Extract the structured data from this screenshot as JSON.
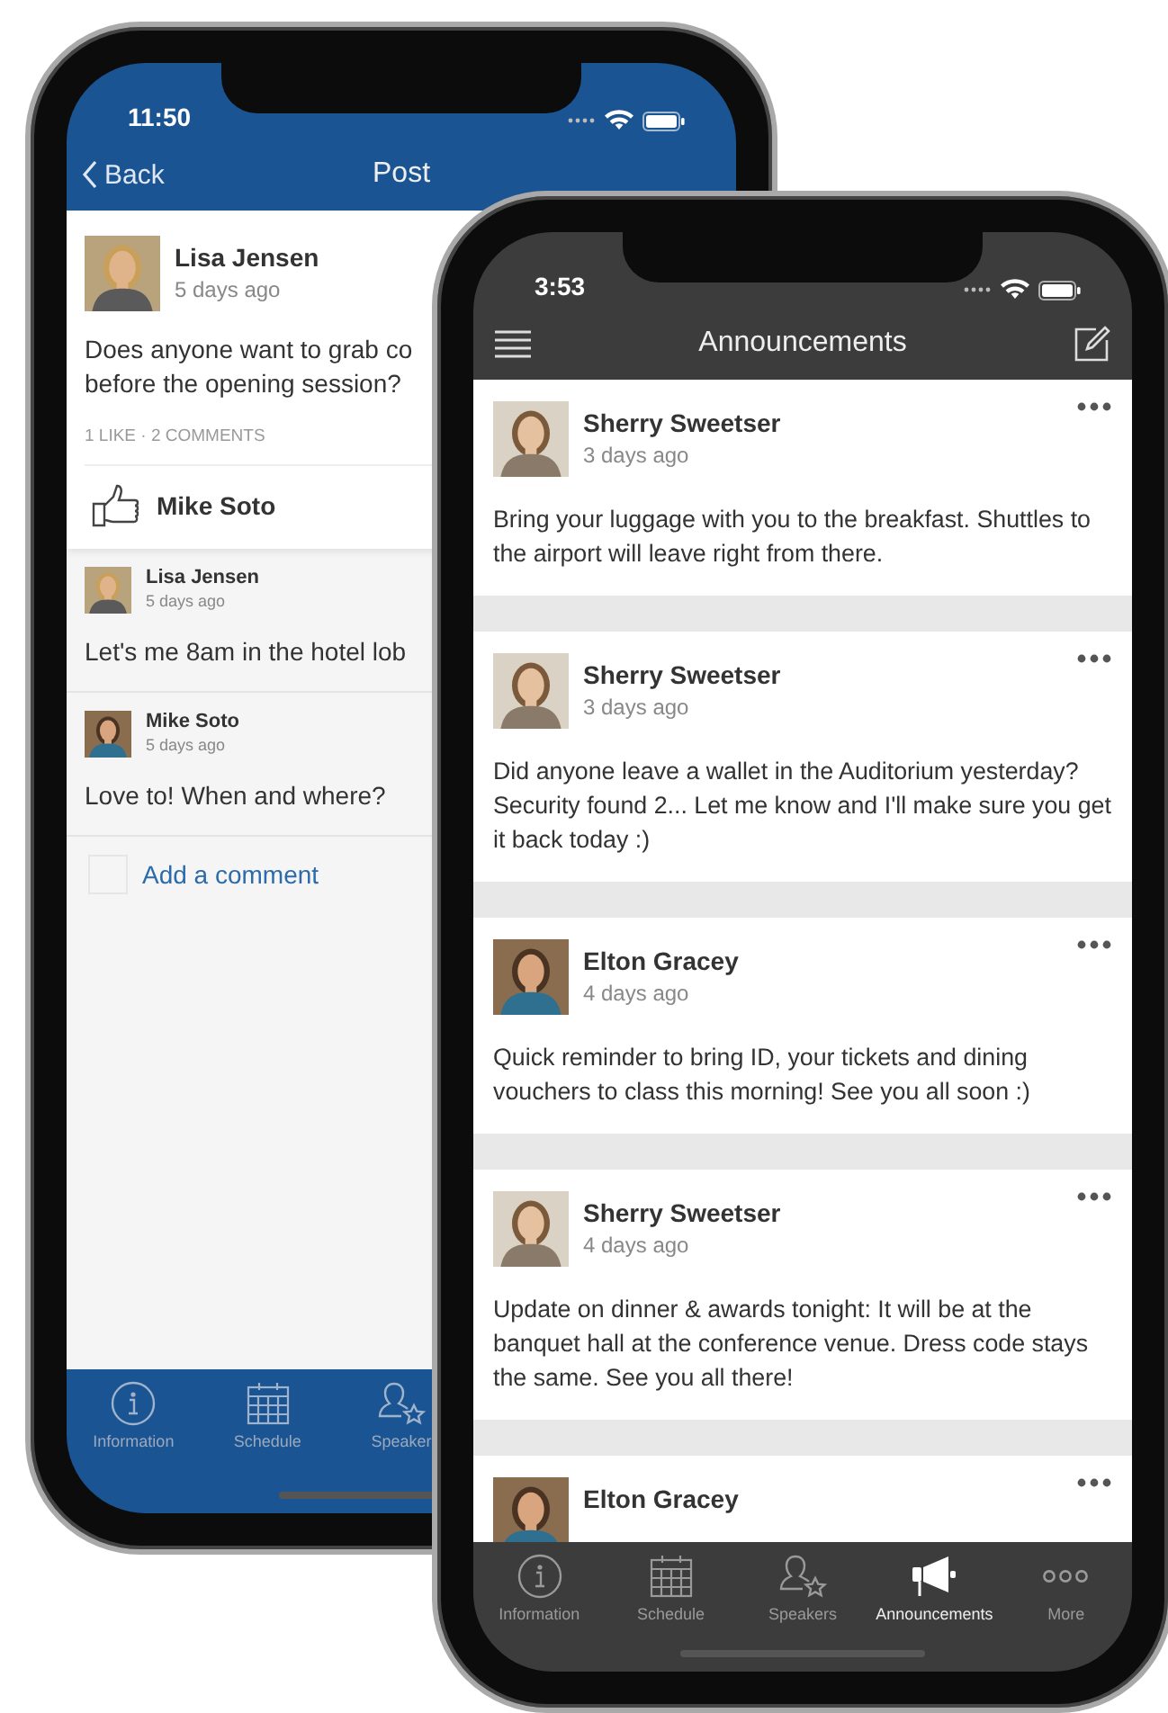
{
  "back_phone": {
    "status_bar": {
      "time": "11:50"
    },
    "nav": {
      "back": "Back",
      "title": "Post"
    },
    "post": {
      "author": "Lisa Jensen",
      "time": "5 days ago",
      "lines": [
        "Does anyone want to grab co",
        "before the opening session?"
      ],
      "summary": "1 LIKE · 2 COMMENTS",
      "likers": [
        "Mike Soto"
      ]
    },
    "comments": [
      {
        "author": "Lisa Jensen",
        "time": "5 days ago",
        "text": "Let's me 8am in the hotel lob"
      },
      {
        "author": "Mike Soto",
        "time": "5 days ago",
        "text": "Love to! When and where?"
      }
    ],
    "comment_field": {
      "placeholder": "Add a comment"
    },
    "tabs": [
      {
        "kind": "info",
        "label": "Information",
        "selected": false
      },
      {
        "kind": "calendar",
        "label": "Schedule",
        "selected": false
      },
      {
        "kind": "speaker",
        "label": "Speaker",
        "selected": false
      }
    ]
  },
  "front_phone": {
    "status_bar": {
      "time": "3:53"
    },
    "nav": {
      "title": "Announcements"
    },
    "posts": [
      {
        "author": "Sherry Sweetser",
        "time": "3 days ago",
        "text": "Bring your luggage with you to the breakfast. Shuttles to the airport will leave right from there."
      },
      {
        "author": "Sherry Sweetser",
        "time": "3 days ago",
        "text": "Did anyone leave a wallet in the Auditorium yesterday? Security found 2... Let me know and I'll make sure you get it back today :)"
      },
      {
        "author": "Elton Gracey",
        "time": "4 days ago",
        "text": "Quick reminder to bring ID, your tickets and dining vouchers to class this morning! See you all soon :)"
      },
      {
        "author": "Sherry Sweetser",
        "time": "4 days ago",
        "text": "Update on dinner & awards tonight: It will be at the banquet hall at the conference venue. Dress code stays the same. See you all there!"
      },
      {
        "author": "Elton Gracey"
      }
    ],
    "tabs": [
      {
        "kind": "info",
        "label": "Information",
        "selected": false
      },
      {
        "kind": "calendar",
        "label": "Schedule",
        "selected": false
      },
      {
        "kind": "speaker",
        "label": "Speakers",
        "selected": false
      },
      {
        "kind": "megaphone",
        "label": "Announcements",
        "selected": true
      },
      {
        "kind": "more",
        "label": "More",
        "selected": false
      }
    ]
  }
}
